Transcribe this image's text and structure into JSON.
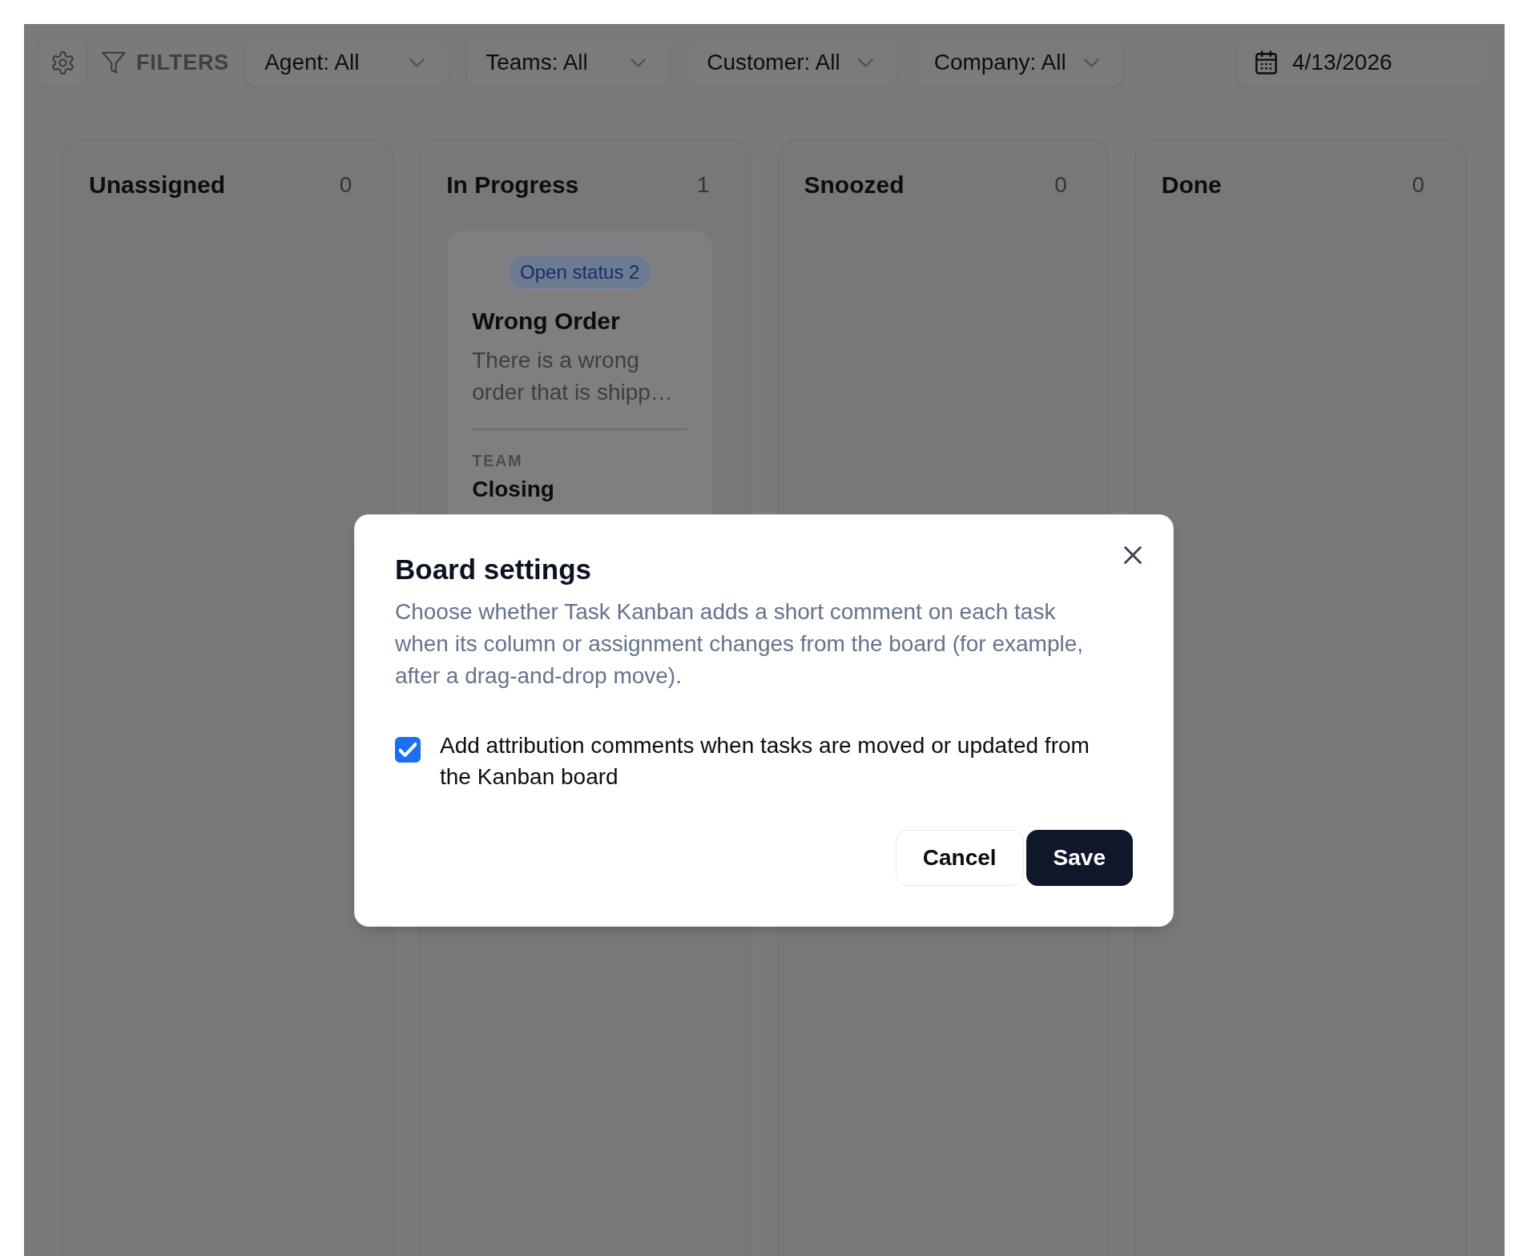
{
  "toolbar": {
    "filters_label": "FILTERS",
    "filters": [
      {
        "label": "Agent: All"
      },
      {
        "label": "Teams: All"
      },
      {
        "label": "Customer: All"
      },
      {
        "label": "Company: All"
      }
    ],
    "date": "4/13/2026"
  },
  "columns": [
    {
      "title": "Unassigned",
      "count": "0"
    },
    {
      "title": "In Progress",
      "count": "1",
      "cards": [
        {
          "status": "Open status 2",
          "title": "Wrong Order",
          "description": "There is a wrong order that is shipp…",
          "team_label": "TEAM",
          "team": "Closing"
        }
      ]
    },
    {
      "title": "Snoozed",
      "count": "0"
    },
    {
      "title": "Done",
      "count": "0"
    }
  ],
  "dialog": {
    "title": "Board settings",
    "description": "Choose whether Task Kanban adds a short comment on each task when its column or assignment changes from the board (for example, after a drag-and-drop move).",
    "option": {
      "label": "Add attribution comments when tasks are moved or updated from the Kanban board",
      "checked": true
    },
    "buttons": [
      {
        "label": "Cancel",
        "kind": "secondary"
      },
      {
        "label": "Save",
        "kind": "primary"
      }
    ]
  }
}
